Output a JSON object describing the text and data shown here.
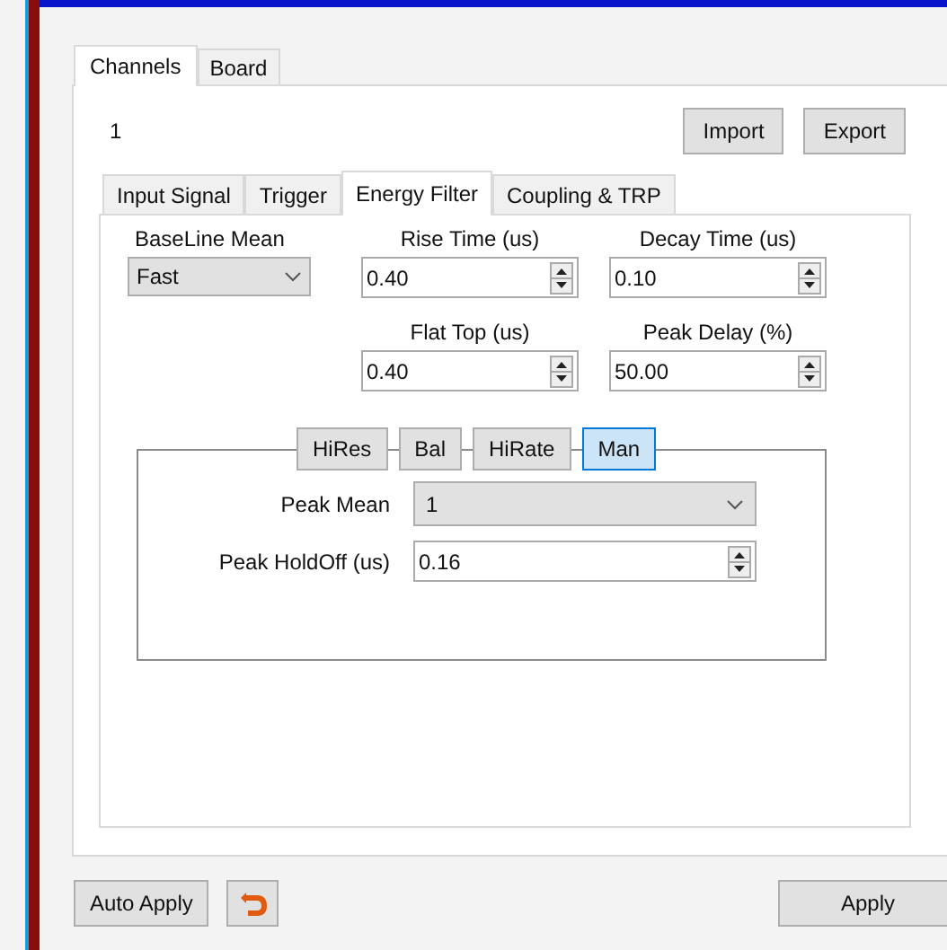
{
  "outer_tabs": [
    {
      "label": "Channels",
      "selected": true
    },
    {
      "label": "Board",
      "selected": false
    }
  ],
  "channel_number": "1",
  "top_buttons": [
    "Import",
    "Export"
  ],
  "inner_tabs": [
    {
      "label": "Input Signal",
      "selected": false
    },
    {
      "label": "Trigger",
      "selected": false
    },
    {
      "label": "Energy Filter",
      "selected": true
    },
    {
      "label": "Coupling & TRP",
      "selected": false
    }
  ],
  "fields": [
    {
      "kind": "combo",
      "label": "BaseLine Mean",
      "value": "Fast"
    },
    {
      "kind": "spin",
      "label": "Rise Time (us)",
      "value": "0.40"
    },
    {
      "kind": "spin",
      "label": "Decay Time (us)",
      "value": "0.10"
    },
    {
      "kind": "empty"
    },
    {
      "kind": "spin",
      "label": "Flat Top (us)",
      "value": "0.40"
    },
    {
      "kind": "spin",
      "label": "Peak Delay (%)",
      "value": "50.00"
    }
  ],
  "modes": [
    {
      "label": "HiRes",
      "selected": false
    },
    {
      "label": "Bal",
      "selected": false
    },
    {
      "label": "HiRate",
      "selected": false
    },
    {
      "label": "Man",
      "selected": true
    }
  ],
  "mode_fields": [
    {
      "kind": "combo",
      "label": "Peak Mean",
      "value": "1"
    },
    {
      "kind": "spin",
      "label": "Peak HoldOff (us)",
      "value": "0.16"
    }
  ],
  "footer": {
    "auto_apply": "Auto Apply",
    "apply": "Apply"
  }
}
